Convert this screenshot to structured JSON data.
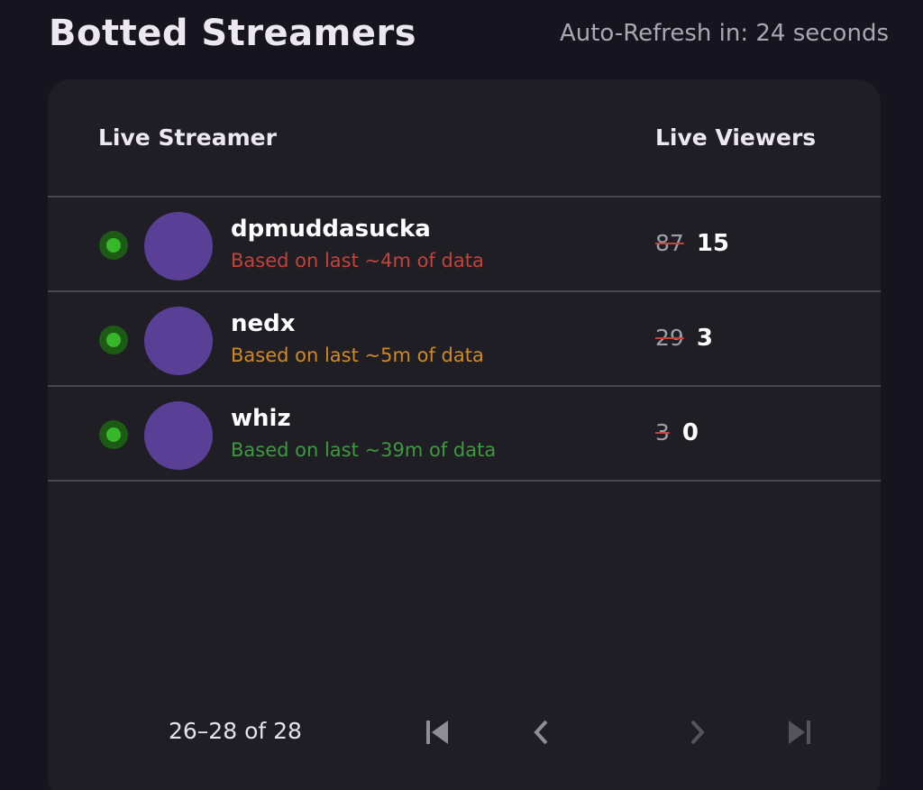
{
  "header": {
    "title": "Botted Streamers",
    "refresh": "Auto-Refresh in: 24 seconds"
  },
  "table": {
    "col_streamer": "Live Streamer",
    "col_viewers": "Live Viewers",
    "rows": [
      {
        "name": "dpmuddasucka",
        "sub": "Based on last ~4m of data",
        "sub_color": "#c0443c",
        "old_viewers": "87",
        "new_viewers": "15",
        "status": "live",
        "status_color": "#36b82a",
        "avatar_color": "#5a3f96"
      },
      {
        "name": "nedx",
        "sub": "Based on last ~5m of data",
        "sub_color": "#d08a22",
        "old_viewers": "29",
        "new_viewers": "3",
        "status": "live",
        "status_color": "#36b82a",
        "avatar_color": "#5a3f96"
      },
      {
        "name": "whiz",
        "sub": "Based on last ~39m of data",
        "sub_color": "#3e9a3e",
        "old_viewers": "3",
        "new_viewers": "0",
        "status": "live",
        "status_color": "#36b82a",
        "avatar_color": "#5a3f96"
      }
    ]
  },
  "pagination": {
    "range": "26–28 of 28",
    "first_icon": "first-page-icon",
    "prev_icon": "chevron-left-icon",
    "next_icon": "chevron-right-icon",
    "last_icon": "last-page-icon"
  },
  "colors": {
    "background": "#16151f",
    "card": "#1f1e24",
    "divider": "#47464d",
    "strike": "#c0443c"
  }
}
